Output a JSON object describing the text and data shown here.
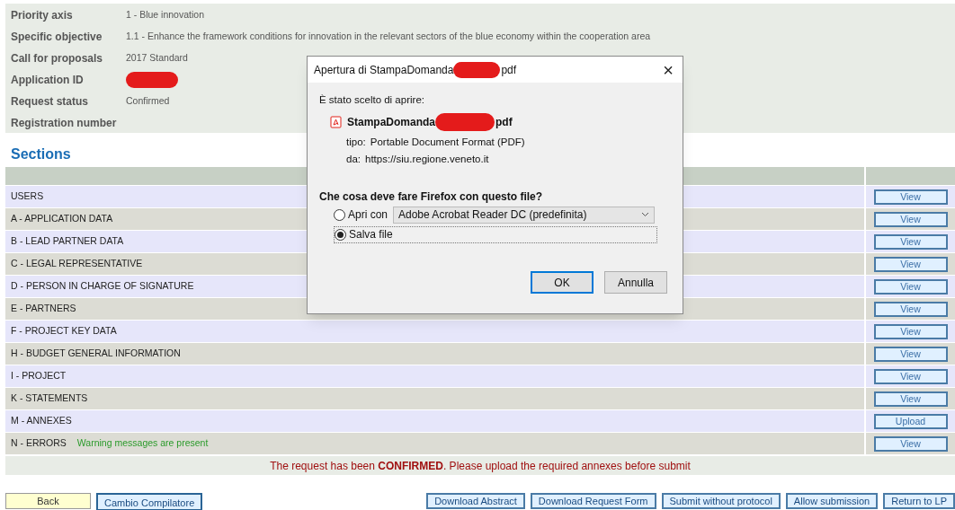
{
  "info": [
    {
      "label": "Priority axis",
      "value": "1 - Blue innovation"
    },
    {
      "label": "Specific objective",
      "value": "1.1 - Enhance the framework conditions for innovation in the relevant sectors of the blue economy within the cooperation area"
    },
    {
      "label": "Call for proposals",
      "value": "2017 Standard"
    },
    {
      "label": "Application ID",
      "redacted": true
    },
    {
      "label": "Request status",
      "value": "Confirmed"
    },
    {
      "label": "Registration number"
    }
  ],
  "sections_title": "Sections",
  "sections": [
    {
      "name": "USERS",
      "action": "View"
    },
    {
      "name": "A - APPLICATION DATA",
      "action": "View"
    },
    {
      "name": "B - LEAD PARTNER DATA",
      "action": "View"
    },
    {
      "name": "C - LEGAL REPRESENTATIVE",
      "action": "View"
    },
    {
      "name": "D - PERSON IN CHARGE OF SIGNATURE",
      "action": "View"
    },
    {
      "name": "E - PARTNERS",
      "action": "View"
    },
    {
      "name": "F - PROJECT KEY DATA",
      "action": "View"
    },
    {
      "name": "H - BUDGET GENERAL INFORMATION",
      "action": "View"
    },
    {
      "name": "I - PROJECT",
      "action": "View"
    },
    {
      "name": "K - STATEMENTS",
      "action": "View"
    },
    {
      "name": "M - ANNEXES",
      "action": "Upload"
    },
    {
      "name": "N - ERRORS",
      "warning": "Warning messages are present",
      "action": "View"
    }
  ],
  "message": "The request has been **CONFIRMED**. Please upload the required annexes before submit",
  "bottom_buttons": [
    {
      "label": "Back",
      "kind": "back"
    },
    {
      "label": "Cambio Compilatore",
      "kind": "plain"
    },
    {
      "label": "Download Abstract",
      "kind": "right"
    },
    {
      "label": "Download Request Form",
      "kind": "right"
    },
    {
      "label": "Submit without protocol",
      "kind": "right"
    },
    {
      "label": "Allow submission",
      "kind": "right"
    },
    {
      "label": "Return to LP",
      "kind": "right"
    }
  ],
  "dialog": {
    "title_start": "Apertura di StampaDomanda",
    "title_end": "pdf",
    "close": "×",
    "intro": "È stato scelto di aprire:",
    "file_start": "StampaDomanda",
    "file_end": "pdf",
    "type_label": "tipo:",
    "type_value": "Portable Document Format (PDF)",
    "from_label": "da:",
    "from_value": "https://siu.regione.veneto.it",
    "question": "Che cosa deve fare Firefox con questo file?",
    "options": [
      {
        "label": "Apri con",
        "selected": false
      },
      {
        "label": "Salva file",
        "selected": true
      }
    ],
    "app": "Adobe Acrobat Reader DC (predefinita)",
    "buttons": [
      "OK",
      "Annulla"
    ]
  }
}
